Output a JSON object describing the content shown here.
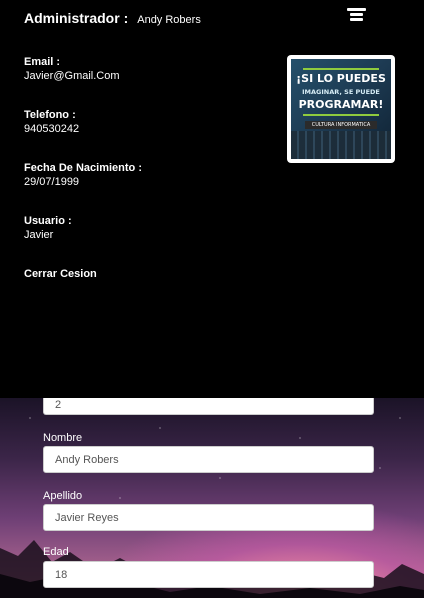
{
  "header": {
    "title": "Administrador :",
    "user_name": "Andy Robers"
  },
  "profile": {
    "fields": [
      {
        "label": "Email :",
        "value": "Javier@Gmail.Com"
      },
      {
        "label": "Telefono :",
        "value": "940530242"
      },
      {
        "label": "Fecha De Nacimiento :",
        "value": "29/07/1999"
      },
      {
        "label": "Usuario :",
        "value": "Javier"
      }
    ],
    "logout_label": "Cerrar Cesion",
    "photo": {
      "line1": "¡SI LO PUEDES",
      "line2": "IMAGINAR, SE PUEDE",
      "line3": "PROGRAMAR!",
      "line4": "CULTURA INFORMATICA"
    }
  },
  "form": {
    "id_value": "2",
    "nombre_label": "Nombre",
    "nombre_value": "Andy Robers",
    "apellido_label": "Apellido",
    "apellido_value": "Javier Reyes",
    "edad_label": "Edad",
    "edad_value": "18"
  },
  "icons": {
    "menu": "menu-icon"
  }
}
